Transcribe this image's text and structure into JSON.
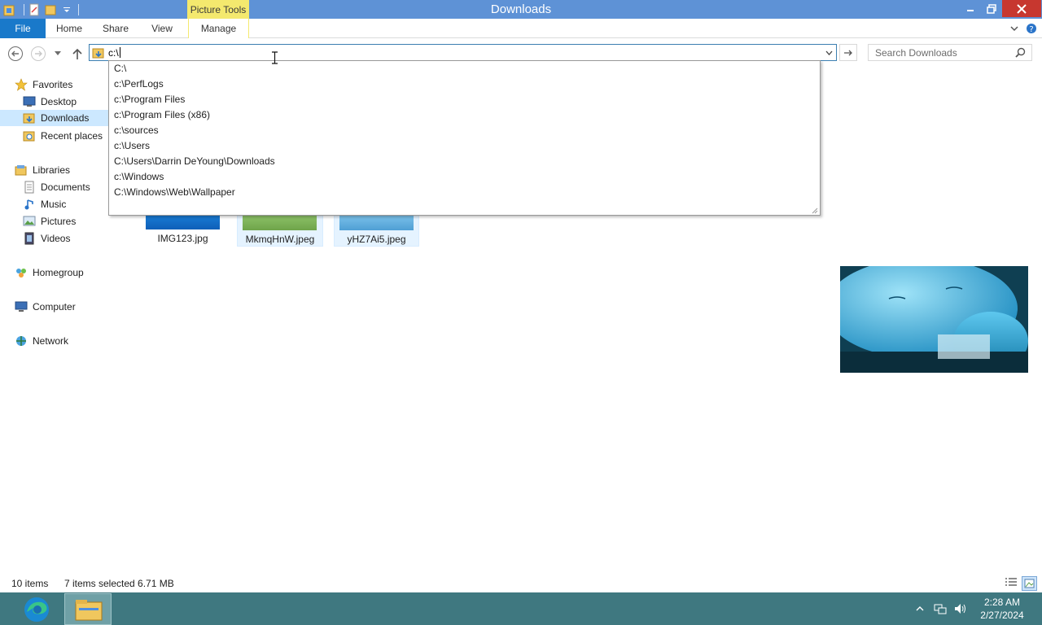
{
  "window": {
    "title": "Downloads",
    "contextual_tab_group": "Picture Tools"
  },
  "ribbon": {
    "tabs": [
      "File",
      "Home",
      "Share",
      "View",
      "Manage"
    ]
  },
  "address": {
    "value": "c:\\"
  },
  "search": {
    "placeholder": "Search Downloads"
  },
  "autocomplete": {
    "items": [
      "C:\\",
      "c:\\PerfLogs",
      "c:\\Program Files",
      "c:\\Program Files (x86)",
      "c:\\sources",
      "c:\\Users",
      "C:\\Users\\Darrin DeYoung\\Downloads",
      "c:\\Windows",
      "C:\\Windows\\Web\\Wallpaper"
    ]
  },
  "sidebar": {
    "favorites": {
      "label": "Favorites",
      "items": [
        "Desktop",
        "Downloads",
        "Recent places"
      ]
    },
    "libraries": {
      "label": "Libraries",
      "items": [
        "Documents",
        "Music",
        "Pictures",
        "Videos"
      ]
    },
    "homegroup": "Homegroup",
    "computer": "Computer",
    "network": "Network"
  },
  "files": [
    {
      "name": "IMG123.jpg",
      "selected": false
    },
    {
      "name": "MkmqHnW.jpeg",
      "selected": true
    },
    {
      "name": "yHZ7Ai5.jpeg",
      "selected": true
    }
  ],
  "status": {
    "item_count": "10 items",
    "selection": "7 items selected  6.71 MB"
  },
  "taskbar": {
    "time": "2:28 AM",
    "date": "2/27/2024"
  },
  "colors": {
    "titlebar": "#5e92d6",
    "file_tab": "#1979ca",
    "picture_tools": "#f4e96e",
    "taskbar": "#3f7880",
    "close_button": "#c7372f",
    "selection": "#cce8ff"
  }
}
